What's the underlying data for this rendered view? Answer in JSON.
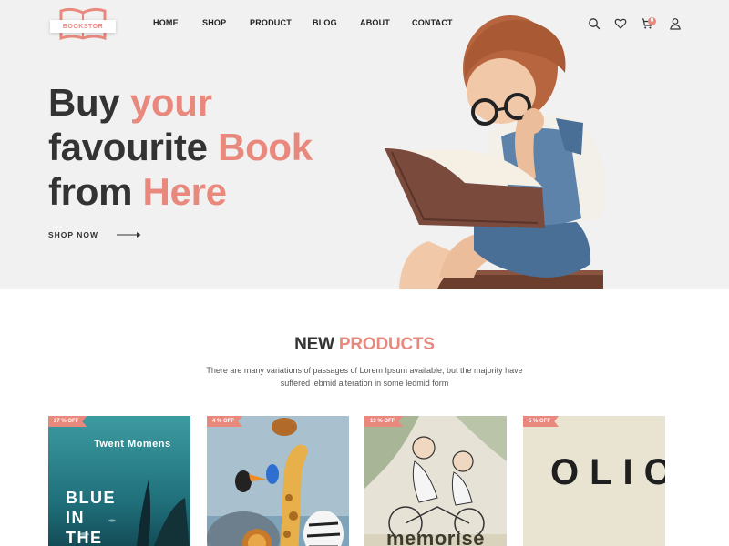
{
  "brand": {
    "logo_text": "BOOKSTOR"
  },
  "nav": {
    "items": [
      {
        "label": "HOME"
      },
      {
        "label": "SHOP"
      },
      {
        "label": "PRODUCT"
      },
      {
        "label": "BLOG"
      },
      {
        "label": "ABOUT"
      },
      {
        "label": "CONTACT"
      }
    ]
  },
  "header_icons": {
    "search": "search-icon",
    "wishlist": "heart-icon",
    "cart": "cart-icon",
    "cart_count": "0",
    "account": "user-icon"
  },
  "hero": {
    "line1_plain": "Buy ",
    "line1_accent": "your",
    "line2_plain": "favourite ",
    "line2_accent": "Book",
    "line3_plain": "from ",
    "line3_accent": "Here",
    "cta_label": "SHOP NOW"
  },
  "colors": {
    "accent": "#e9897e",
    "hero_bg": "#f1f1f1",
    "text_dark": "#333333"
  },
  "new_products": {
    "title_plain": "NEW ",
    "title_accent": "PRODUCTS",
    "description_line1": "There are many variations of passages of Lorem Ipsum available, but the majority have",
    "description_line2": "suffered lebmid alteration in some ledmid form",
    "items": [
      {
        "discount": "27 % OFF",
        "cover_title": "Twent Momens",
        "cover_text_1": "BLUE",
        "cover_text_2": "IN",
        "cover_text_3": "THE"
      },
      {
        "discount": "4 % OFF"
      },
      {
        "discount": "13 % OFF",
        "cover_text": "memorise"
      },
      {
        "discount": "5 % OFF",
        "cover_text_1": "OLIO"
      }
    ]
  }
}
